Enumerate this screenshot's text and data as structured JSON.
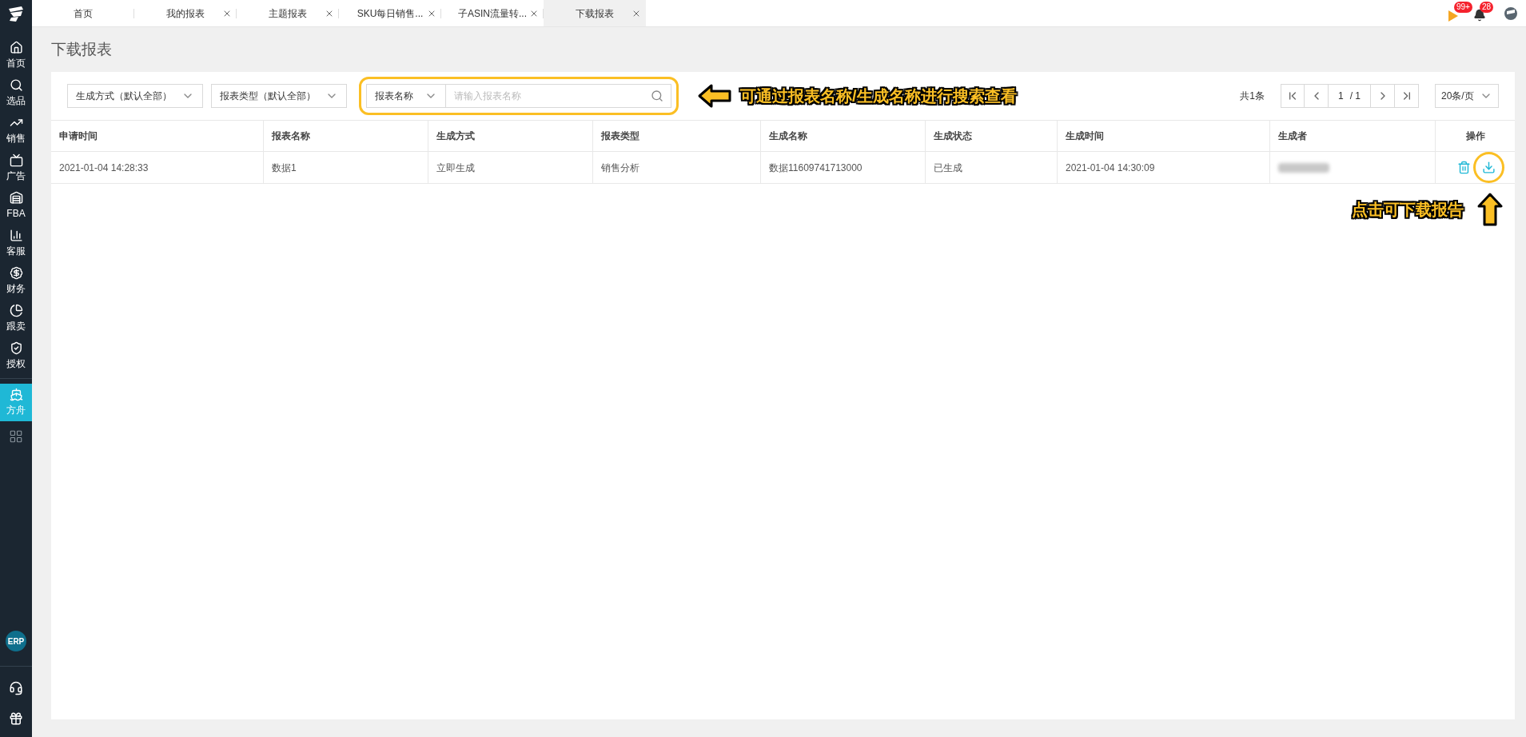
{
  "sidebar": {
    "items": [
      {
        "label": "首页",
        "selected": false
      },
      {
        "label": "选品",
        "selected": false
      },
      {
        "label": "销售",
        "selected": false
      },
      {
        "label": "广告",
        "selected": false
      },
      {
        "label": "FBA",
        "selected": false
      },
      {
        "label": "客服",
        "selected": false
      },
      {
        "label": "财务",
        "selected": false
      },
      {
        "label": "跟卖",
        "selected": false
      },
      {
        "label": "授权",
        "selected": false
      },
      {
        "label": "方舟",
        "selected": true
      }
    ],
    "erp_badge": "ERP"
  },
  "tabs": [
    {
      "label": "首页",
      "closable": false,
      "selected": false
    },
    {
      "label": "我的报表",
      "closable": true,
      "selected": false
    },
    {
      "label": "主题报表",
      "closable": true,
      "selected": false
    },
    {
      "label": "SKU每日销售...",
      "closable": true,
      "selected": false
    },
    {
      "label": "子ASIN流量转...",
      "closable": true,
      "selected": false
    },
    {
      "label": "下载报表",
      "closable": true,
      "selected": true
    }
  ],
  "notifications": {
    "flag_count": "99+",
    "bell_count": "28"
  },
  "page_title": "下载报表",
  "filters": [
    {
      "label": "生成方式（默认全部）"
    },
    {
      "label": "报表类型（默认全部）"
    }
  ],
  "search": {
    "field_select": "报表名称",
    "placeholder": "请输入报表名称"
  },
  "pagination": {
    "total": "共1条",
    "page": "1",
    "pages": "/ 1",
    "page_size": "20条/页"
  },
  "table": {
    "columns": [
      "申请时间",
      "报表名称",
      "生成方式",
      "报表类型",
      "生成名称",
      "生成状态",
      "生成时间",
      "生成者",
      "操作"
    ],
    "rows": [
      {
        "cells": [
          "2021-01-04 14:28:33",
          "数据1",
          "立即生成",
          "销售分析",
          "数据11609741713000",
          "已生成",
          "2021-01-04 14:30:09"
        ],
        "creator_redacted": true
      }
    ]
  },
  "annotations": [
    {
      "text": "可通过报表名称/生成名称进行搜索查看"
    },
    {
      "text": "点击可下载报告"
    }
  ]
}
